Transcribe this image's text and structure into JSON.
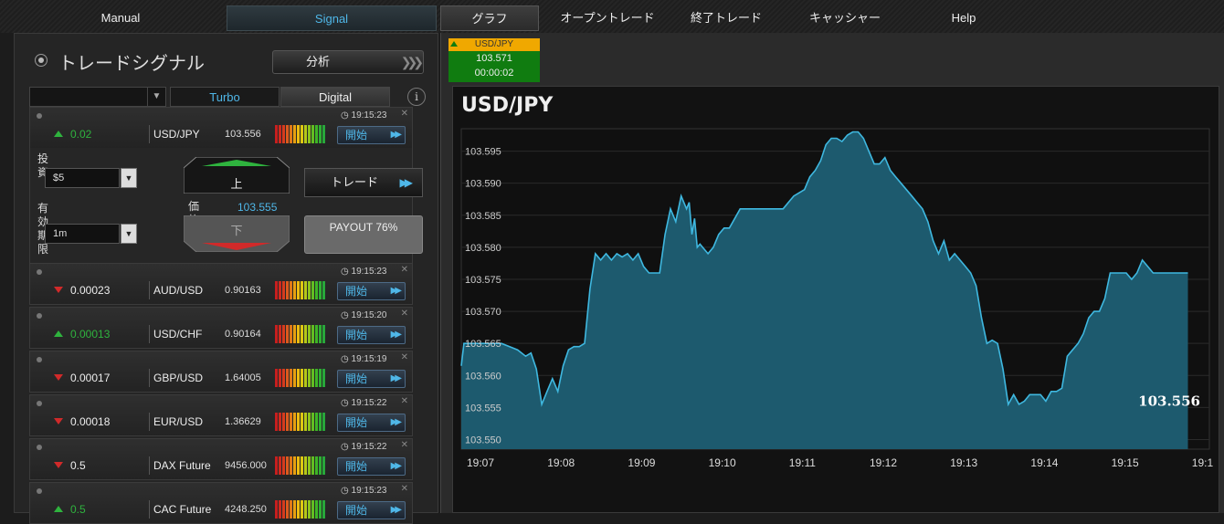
{
  "nav": {
    "tabs": [
      {
        "label": "Manual"
      },
      {
        "label": "Signal"
      },
      {
        "label": "グラフ"
      },
      {
        "label": "オープントレード"
      },
      {
        "label": "終了トレード"
      },
      {
        "label": "キャッシャー"
      },
      {
        "label": "Help"
      }
    ]
  },
  "panel": {
    "title": "トレードシグナル",
    "analyze_label": "分析",
    "modes": {
      "turbo": "Turbo",
      "digital": "Digital"
    },
    "info": "i",
    "start_label": "開始"
  },
  "signals": [
    {
      "direction": "up",
      "change": "0.02",
      "symbol": "USD/JPY",
      "price": "103.556",
      "time": "19:15:23"
    },
    {
      "direction": "down",
      "change": "0.00023",
      "symbol": "AUD/USD",
      "price": "0.90163",
      "time": "19:15:23"
    },
    {
      "direction": "up",
      "change": "0.00013",
      "symbol": "USD/CHF",
      "price": "0.90164",
      "time": "19:15:20"
    },
    {
      "direction": "down",
      "change": "0.00017",
      "symbol": "GBP/USD",
      "price": "1.64005",
      "time": "19:15:19"
    },
    {
      "direction": "down",
      "change": "0.00018",
      "symbol": "EUR/USD",
      "price": "1.36629",
      "time": "19:15:22"
    },
    {
      "direction": "down",
      "change": "0.5",
      "symbol": "DAX Future",
      "price": "9456.000",
      "time": "19:15:22"
    },
    {
      "direction": "up",
      "change": "0.5",
      "symbol": "CAC Future",
      "price": "4248.250",
      "time": "19:15:23"
    }
  ],
  "trade_form": {
    "invest_label": "投資",
    "invest_value": "$5",
    "expiry_label": "有効期限",
    "expiry_value": "1m",
    "up_label": "上",
    "down_label": "下",
    "price_label": "価格",
    "price_value": "103.555",
    "trade_label": "トレード",
    "payout": "PAYOUT 76%"
  },
  "mini_tab": {
    "symbol": "USD/JPY",
    "price": "103.571",
    "countdown": "00:00:02"
  },
  "colors": {
    "accent": "#4fb7e8",
    "up": "#2fb33e",
    "down": "#d12a2a",
    "area": "#1d5a6e",
    "line": "#3fb8e0"
  },
  "chart_data": {
    "type": "area",
    "title": "USD/JPY",
    "y_ticks": [
      "103.595",
      "103.590",
      "103.585",
      "103.580",
      "103.575",
      "103.570",
      "103.565",
      "103.560",
      "103.555",
      "103.550"
    ],
    "x_ticks": [
      "19:07",
      "19:08",
      "19:09",
      "19:10",
      "19:11",
      "19:12",
      "19:13",
      "19:14",
      "19:15",
      "19:1"
    ],
    "ylim": [
      103.5485,
      103.5985
    ],
    "current_label": "103.556",
    "x": [
      "19:07:00",
      "19:07:02",
      "19:07:06",
      "19:07:30",
      "19:07:42",
      "19:07:48",
      "19:07:52",
      "19:07:56",
      "19:08:00",
      "19:08:04",
      "19:08:08",
      "19:08:12",
      "19:08:16",
      "19:08:20",
      "19:08:24",
      "19:08:28",
      "19:08:32",
      "19:08:36",
      "19:08:40",
      "19:08:44",
      "19:08:48",
      "19:08:52",
      "19:08:56",
      "19:09:00",
      "19:09:04",
      "19:09:08",
      "19:09:12",
      "19:09:16",
      "19:09:20",
      "19:09:24",
      "19:09:28",
      "19:09:32",
      "19:09:36",
      "19:09:40",
      "19:09:44",
      "19:09:48",
      "19:09:50",
      "19:09:52",
      "19:09:54",
      "19:09:56",
      "19:09:58",
      "19:10:00",
      "19:10:04",
      "19:10:08",
      "19:10:12",
      "19:10:16",
      "19:10:20",
      "19:10:24",
      "19:10:28",
      "19:10:32",
      "19:10:36",
      "19:10:40",
      "19:10:44",
      "19:10:48",
      "19:10:52",
      "19:10:56",
      "19:11:00",
      "19:11:04",
      "19:11:08",
      "19:11:12",
      "19:11:16",
      "19:11:20",
      "19:11:24",
      "19:11:28",
      "19:11:32",
      "19:11:36",
      "19:11:40",
      "19:11:44",
      "19:11:48",
      "19:11:52",
      "19:11:56",
      "19:12:00",
      "19:12:04",
      "19:12:08",
      "19:12:12",
      "19:12:16",
      "19:12:20",
      "19:12:24",
      "19:12:28",
      "19:12:32",
      "19:12:36",
      "19:12:40",
      "19:12:44",
      "19:12:48",
      "19:12:52",
      "19:12:56",
      "19:13:00",
      "19:13:04",
      "19:13:08",
      "19:13:12",
      "19:13:16",
      "19:13:20",
      "19:13:24",
      "19:13:28",
      "19:13:32",
      "19:13:36",
      "19:13:40",
      "19:13:44",
      "19:13:48",
      "19:13:52",
      "19:13:56",
      "19:14:00",
      "19:14:04",
      "19:14:08",
      "19:14:12",
      "19:14:16",
      "19:14:20",
      "19:14:24",
      "19:14:28",
      "19:14:32",
      "19:14:36",
      "19:14:40",
      "19:14:44",
      "19:14:48",
      "19:14:52",
      "19:14:56",
      "19:15:00",
      "19:15:04",
      "19:15:08",
      "19:15:12",
      "19:15:16",
      "19:15:20",
      "19:15:24",
      "19:15:28",
      "19:15:32",
      "19:15:36",
      "19:15:40",
      "19:15:44",
      "19:15:48",
      "19:15:52",
      "19:15:56",
      "19:15:58",
      "19:16:00",
      "19:16:02"
    ],
    "values": [
      103.5615,
      103.565,
      103.565,
      103.565,
      103.564,
      103.563,
      103.5635,
      103.561,
      103.5555,
      103.5575,
      103.5595,
      103.5575,
      103.5615,
      103.564,
      103.5645,
      103.5645,
      103.565,
      103.5735,
      103.579,
      103.578,
      103.579,
      103.578,
      103.579,
      103.5785,
      103.579,
      103.578,
      103.579,
      103.577,
      103.576,
      103.576,
      103.576,
      103.582,
      103.586,
      103.584,
      103.588,
      103.586,
      103.587,
      103.582,
      103.5845,
      103.58,
      103.5805,
      103.58,
      103.579,
      103.58,
      103.582,
      103.583,
      103.583,
      103.5845,
      103.586,
      103.586,
      103.586,
      103.586,
      103.586,
      103.586,
      103.586,
      103.586,
      103.586,
      103.587,
      103.588,
      103.5885,
      103.589,
      103.591,
      103.592,
      103.5935,
      103.596,
      103.597,
      103.597,
      103.5965,
      103.5975,
      103.598,
      103.598,
      103.597,
      103.595,
      103.593,
      103.593,
      103.594,
      103.592,
      103.591,
      103.59,
      103.589,
      103.588,
      103.587,
      103.586,
      103.584,
      103.581,
      103.579,
      103.581,
      103.578,
      103.579,
      103.578,
      103.577,
      103.576,
      103.574,
      103.569,
      103.565,
      103.5655,
      103.565,
      103.561,
      103.5555,
      103.557,
      103.5555,
      103.556,
      103.557,
      103.557,
      103.557,
      103.556,
      103.5575,
      103.5575,
      103.558,
      103.563,
      103.564,
      103.565,
      103.5665,
      103.569,
      103.57,
      103.57,
      103.572,
      103.576,
      103.576,
      103.576,
      103.576,
      103.575,
      103.576,
      103.578,
      103.577,
      103.576,
      103.576,
      103.576,
      103.576,
      103.576,
      103.576,
      103.576,
      103.576,
      103.576,
      103.5665,
      103.556
    ]
  }
}
